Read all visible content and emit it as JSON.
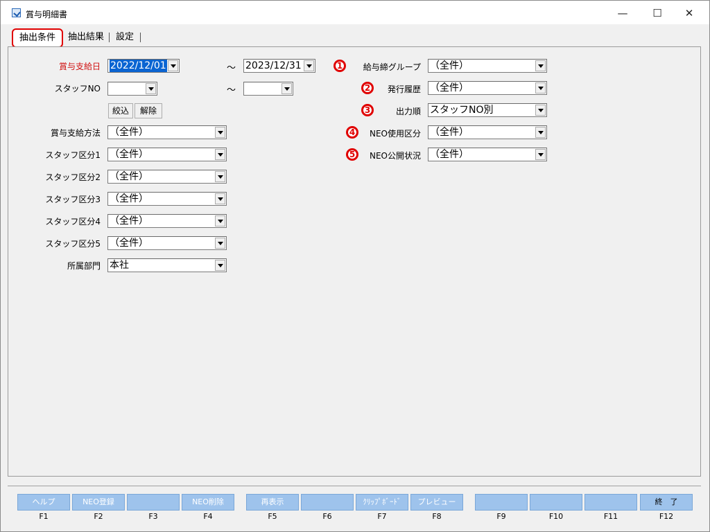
{
  "window": {
    "title": "賞与明細書",
    "minimize": "—",
    "maximize": "☐",
    "close": "✕"
  },
  "tabs": [
    {
      "label": "抽出条件"
    },
    {
      "label": "抽出結果"
    },
    {
      "label": "設定"
    }
  ],
  "left": {
    "bonus_date_label": "賞与支給日",
    "bonus_date_from": "2022/12/01",
    "tilde1": "～",
    "bonus_date_to": "2023/12/31",
    "staff_no_label": "スタッフNO",
    "staff_no_from": "",
    "tilde2": "～",
    "staff_no_to": "",
    "filter_button": "絞込",
    "clear_button": "解除",
    "pay_method_label": "賞与支給方法",
    "pay_method_value": "（全件）",
    "staff_class1_label": "スタッフ区分1",
    "staff_class1_value": "（全件）",
    "staff_class2_label": "スタッフ区分2",
    "staff_class2_value": "（全件）",
    "staff_class3_label": "スタッフ区分3",
    "staff_class3_value": "（全件）",
    "staff_class4_label": "スタッフ区分4",
    "staff_class4_value": "（全件）",
    "staff_class5_label": "スタッフ区分5",
    "staff_class5_value": "（全件）",
    "department_label": "所属部門",
    "department_value": "本社"
  },
  "right": [
    {
      "num": "1",
      "label": "給与締グループ",
      "value": "（全件）"
    },
    {
      "num": "2",
      "label": "発行履歴",
      "value": "（全件）"
    },
    {
      "num": "3",
      "label": "出力順",
      "value": "スタッフNO別"
    },
    {
      "num": "4",
      "label": "NEO使用区分",
      "value": "（全件）"
    },
    {
      "num": "5",
      "label": "NEO公開状況",
      "value": "（全件）"
    }
  ],
  "fkeys": [
    {
      "label": "ヘルプ",
      "key": "F1"
    },
    {
      "label": "NEO登録",
      "key": "F2"
    },
    {
      "label": "",
      "key": "F3"
    },
    {
      "label": "NEO削除",
      "key": "F4"
    },
    {
      "label": "再表示",
      "key": "F5"
    },
    {
      "label": "",
      "key": "F6"
    },
    {
      "label": "ｸﾘｯﾌﾟﾎﾞｰﾄﾞ",
      "key": "F7"
    },
    {
      "label": "プレビュー",
      "key": "F8"
    },
    {
      "label": "",
      "key": "F9"
    },
    {
      "label": "",
      "key": "F10"
    },
    {
      "label": "",
      "key": "F11"
    },
    {
      "label": "終　了",
      "key": "F12"
    }
  ],
  "colors": {
    "accent_red": "#e00000",
    "fkey_blue": "#9ec3ec",
    "selection": "#0a64d2"
  }
}
